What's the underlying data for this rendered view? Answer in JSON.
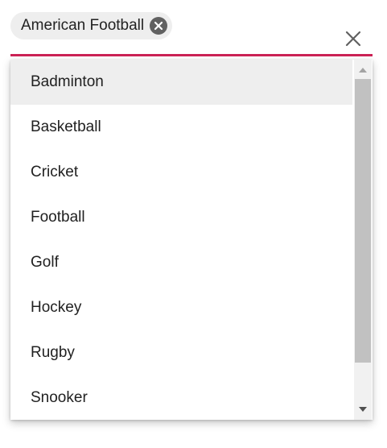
{
  "selected_chips": [
    {
      "label": "American Football"
    }
  ],
  "icons": {
    "chip_remove": "circle-x-icon",
    "clear": "close-icon",
    "scroll_up": "triangle-up-icon",
    "scroll_down": "triangle-down-icon"
  },
  "colors": {
    "accent_underline": "#cc2256",
    "chip_background": "#eeeeee",
    "active_item_background": "#eeeeee"
  },
  "dropdown": {
    "items": [
      {
        "label": "Badminton",
        "active": true
      },
      {
        "label": "Basketball",
        "active": false
      },
      {
        "label": "Cricket",
        "active": false
      },
      {
        "label": "Football",
        "active": false
      },
      {
        "label": "Golf",
        "active": false
      },
      {
        "label": "Hockey",
        "active": false
      },
      {
        "label": "Rugby",
        "active": false
      },
      {
        "label": "Snooker",
        "active": false
      }
    ]
  }
}
